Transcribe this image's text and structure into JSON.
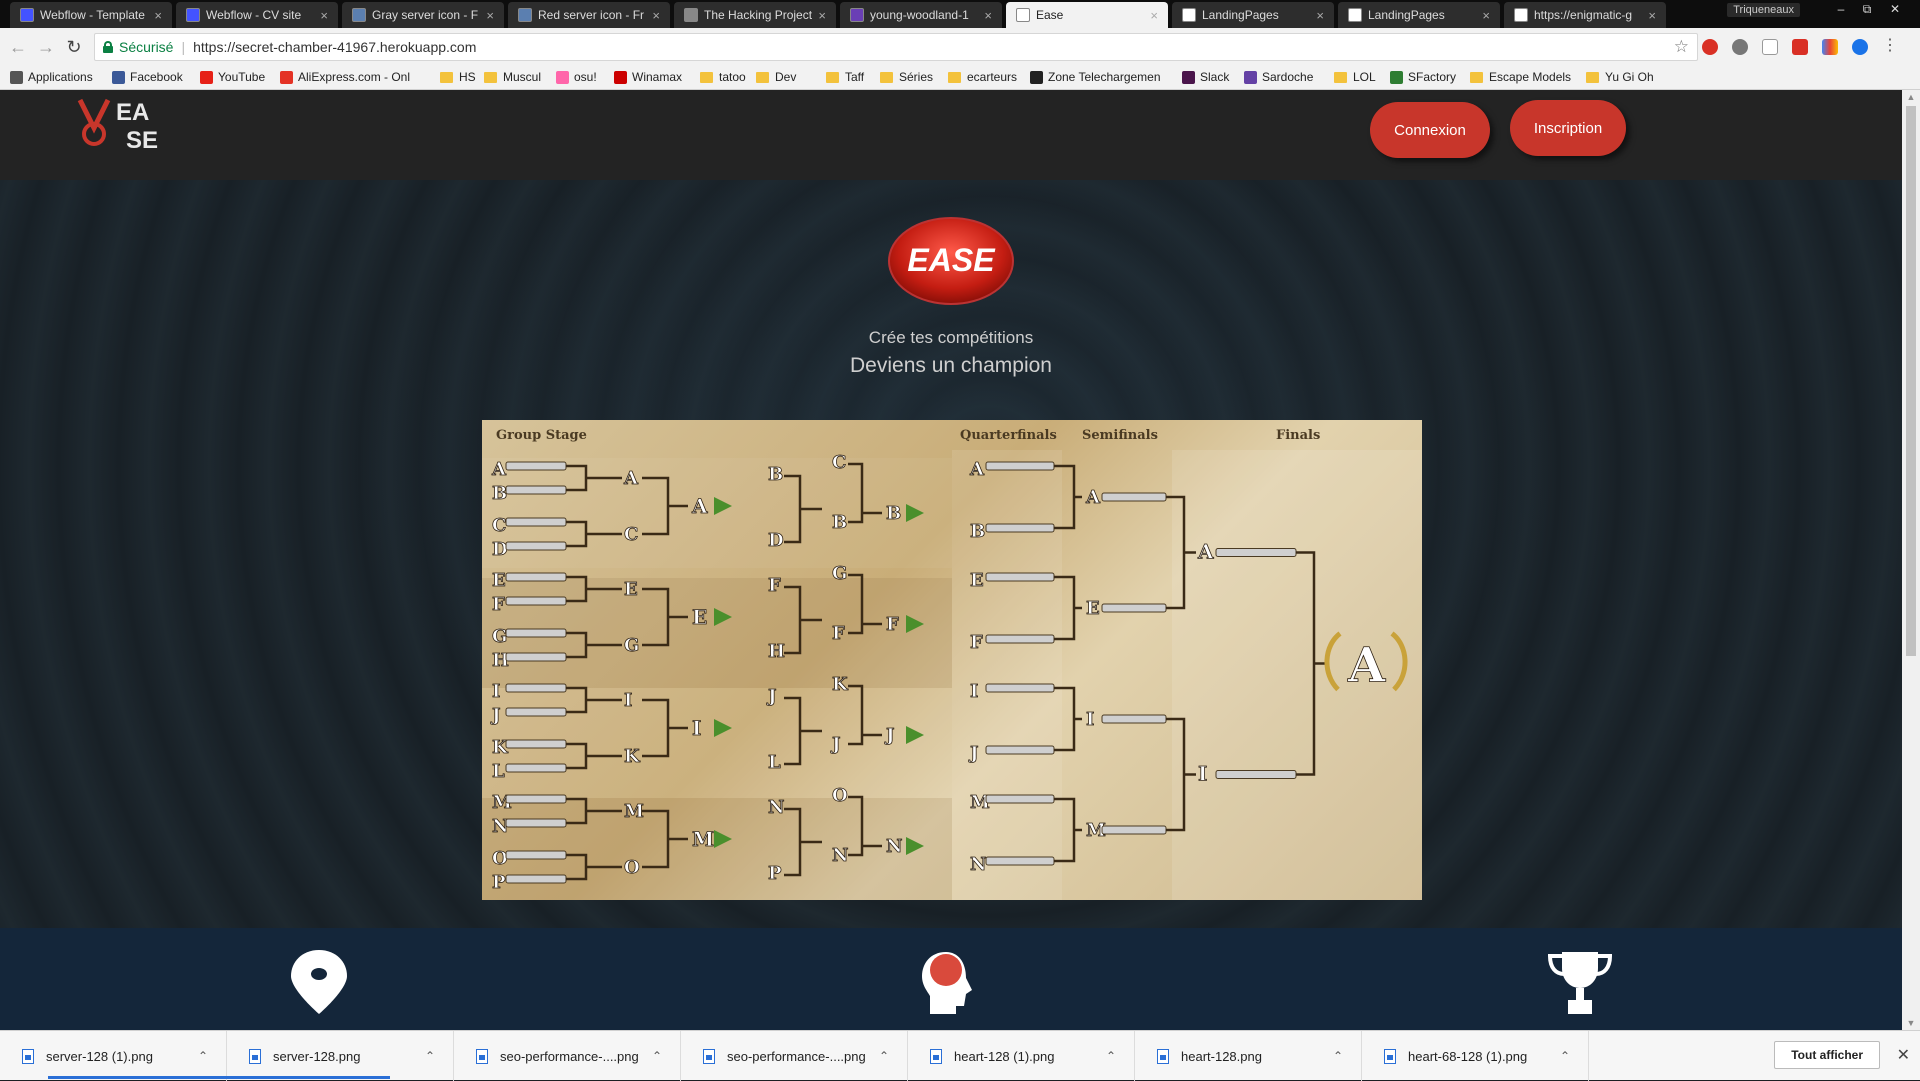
{
  "browser": {
    "tabs": [
      {
        "title": "Webflow - Template",
        "favicon_color": "#4353ff",
        "active": false
      },
      {
        "title": "Webflow - CV site",
        "favicon_color": "#4353ff",
        "active": false
      },
      {
        "title": "Gray server icon - F",
        "favicon_color": "#5b7fb0",
        "active": false
      },
      {
        "title": "Red server icon - Fr",
        "favicon_color": "#5b7fb0",
        "active": false
      },
      {
        "title": "The Hacking Project",
        "favicon_color": "#888888",
        "active": false
      },
      {
        "title": "young-woodland-1",
        "favicon_color": "#6a3fb5",
        "active": false
      },
      {
        "title": "Ease",
        "favicon_color": "#ffffff",
        "active": true
      },
      {
        "title": "LandingPages",
        "favicon_color": "#ffffff",
        "active": false
      },
      {
        "title": "LandingPages",
        "favicon_color": "#ffffff",
        "active": false
      },
      {
        "title": "https://enigmatic-g",
        "favicon_color": "#ffffff",
        "active": false
      }
    ],
    "window_user": "Triqueneaux",
    "address": {
      "secure_label": "Sécurisé",
      "url": "https://secret-chamber-41967.herokuapp.com"
    },
    "bookmarks": [
      {
        "label": "Applications",
        "kind": "apps-icon"
      },
      {
        "label": "Facebook",
        "kind": "facebook-icon"
      },
      {
        "label": "YouTube",
        "kind": "youtube-icon"
      },
      {
        "label": "AliExpress.com - Onl",
        "kind": "aliexpress-icon"
      },
      {
        "label": "HS",
        "kind": "folder-icon"
      },
      {
        "label": "Muscul",
        "kind": "folder-icon"
      },
      {
        "label": "osu!",
        "kind": "osu-icon"
      },
      {
        "label": "Winamax",
        "kind": "winamax-icon"
      },
      {
        "label": "tatoo",
        "kind": "folder-icon"
      },
      {
        "label": "Dev",
        "kind": "folder-icon"
      },
      {
        "label": "Taff",
        "kind": "folder-icon"
      },
      {
        "label": "Séries",
        "kind": "folder-icon"
      },
      {
        "label": "ecarteurs",
        "kind": "folder-icon"
      },
      {
        "label": "Zone Telechargemen",
        "kind": "zt-icon"
      },
      {
        "label": "Slack",
        "kind": "slack-icon"
      },
      {
        "label": "Sardoche",
        "kind": "twitch-icon"
      },
      {
        "label": "LOL",
        "kind": "folder-icon"
      },
      {
        "label": "SFactory",
        "kind": "dollar-icon"
      },
      {
        "label": "Escape Models",
        "kind": "folder-icon"
      },
      {
        "label": "Yu Gi Oh",
        "kind": "folder-icon"
      }
    ]
  },
  "site": {
    "logo_text_top": "EA",
    "logo_text_bottom": "SE",
    "login_label": "Connexion",
    "signup_label": "Inscription",
    "badge_text": "EASE",
    "tagline_1": "Crée tes compétitions",
    "tagline_2": "Deviens un champion",
    "accent_color": "#c8362b",
    "bracket": {
      "stage_titles": {
        "group": "Group Stage",
        "qf": "Quarterfinals",
        "sf": "Semifinals",
        "final": "Finals"
      },
      "groups": [
        {
          "seeds": [
            "A",
            "B",
            "C",
            "D"
          ],
          "winners": [
            "A",
            "C"
          ],
          "group_winner": "A",
          "pairs": [
            "B",
            "D"
          ],
          "pair_winners": [
            "C",
            "B"
          ],
          "second": "B"
        },
        {
          "seeds": [
            "E",
            "F",
            "G",
            "H"
          ],
          "winners": [
            "E",
            "G"
          ],
          "group_winner": "E",
          "pairs": [
            "F",
            "H"
          ],
          "pair_winners": [
            "G",
            "F"
          ],
          "second": "F"
        },
        {
          "seeds": [
            "I",
            "J",
            "K",
            "L"
          ],
          "winners": [
            "I",
            "K"
          ],
          "group_winner": "I",
          "pairs": [
            "J",
            "L"
          ],
          "pair_winners": [
            "K",
            "J"
          ],
          "second": "J"
        },
        {
          "seeds": [
            "M",
            "N",
            "O",
            "P"
          ],
          "winners": [
            "M",
            "O"
          ],
          "group_winner": "M",
          "pairs": [
            "N",
            "P"
          ],
          "pair_winners": [
            "O",
            "N"
          ],
          "second": "N"
        }
      ],
      "quarterfinals": [
        "A",
        "B",
        "E",
        "F",
        "I",
        "J",
        "M",
        "N"
      ],
      "semifinals": [
        "A",
        "E",
        "I",
        "M"
      ],
      "finals": [
        "A",
        "I"
      ],
      "champion": "A"
    },
    "features": [
      {
        "icon": "map-pin-icon"
      },
      {
        "icon": "head-idea-icon"
      },
      {
        "icon": "trophy-icon"
      }
    ]
  },
  "downloads": {
    "items": [
      "server-128 (1).png",
      "server-128.png",
      "seo-performance-....png",
      "seo-performance-....png",
      "heart-128 (1).png",
      "heart-128.png",
      "heart-68-128 (1).png"
    ],
    "show_all_label": "Tout afficher"
  }
}
